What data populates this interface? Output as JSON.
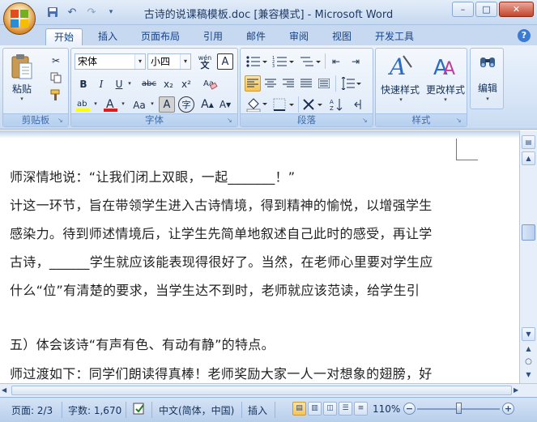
{
  "title": "古诗的说课稿模板.doc [兼容模式] - Microsoft Word",
  "qat": {
    "save_icon": "save-icon",
    "undo_icon": "undo-icon",
    "redo_icon": "redo-icon",
    "customize_icon": "chevron-down-icon"
  },
  "window_buttons": {
    "minimize": "–",
    "maximize": "□",
    "close": "✕"
  },
  "tabs": [
    {
      "label": "开始",
      "active": true
    },
    {
      "label": "插入"
    },
    {
      "label": "页面布局"
    },
    {
      "label": "引用"
    },
    {
      "label": "邮件"
    },
    {
      "label": "审阅"
    },
    {
      "label": "视图"
    },
    {
      "label": "开发工具"
    }
  ],
  "ribbon": {
    "clipboard": {
      "label": "剪贴板",
      "paste": "粘贴"
    },
    "font": {
      "label": "字体",
      "font_name": "宋体",
      "font_size": "小四",
      "wen_btn": "wén\n文",
      "bold": "B",
      "italic": "I",
      "underline": "U",
      "strike": "abc",
      "subscript": "x₂",
      "superscript": "x²",
      "aa_btn": "Aa",
      "a_btn": "A",
      "wen_circle": "字"
    },
    "paragraph": {
      "label": "段落"
    },
    "styles": {
      "label": "样式",
      "quick_styles": "快速样式",
      "change_styles": "更改样式"
    },
    "editing": {
      "label": "编辑"
    }
  },
  "document": {
    "lines": [
      "师深情地说：“让我们闭上双眼，一起_______！”",
      "计这一环节，旨在带领学生进入古诗情境，得到精神的愉悦，以增强学生",
      "感染力。待到师述情境后，让学生先简单地叙述自己此时的感受，再让学",
      "古诗，______学生就应该能表现得很好了。当然，在老师心里要对学生应",
      "什么“位”有清楚的要求，当学生达不到时，老师就应该范读，给学生引",
      "",
      "五）体会该诗“有声有色、有动有静”的特点。",
      "师过渡如下：同学们朗读得真棒！老师奖励大家一人一对想象的翅膀，好"
    ]
  },
  "status": {
    "page": "页面: 2/3",
    "words": "字数: 1,670",
    "language": "中文(简体，中国)",
    "mode": "插入",
    "zoom": "110%"
  }
}
